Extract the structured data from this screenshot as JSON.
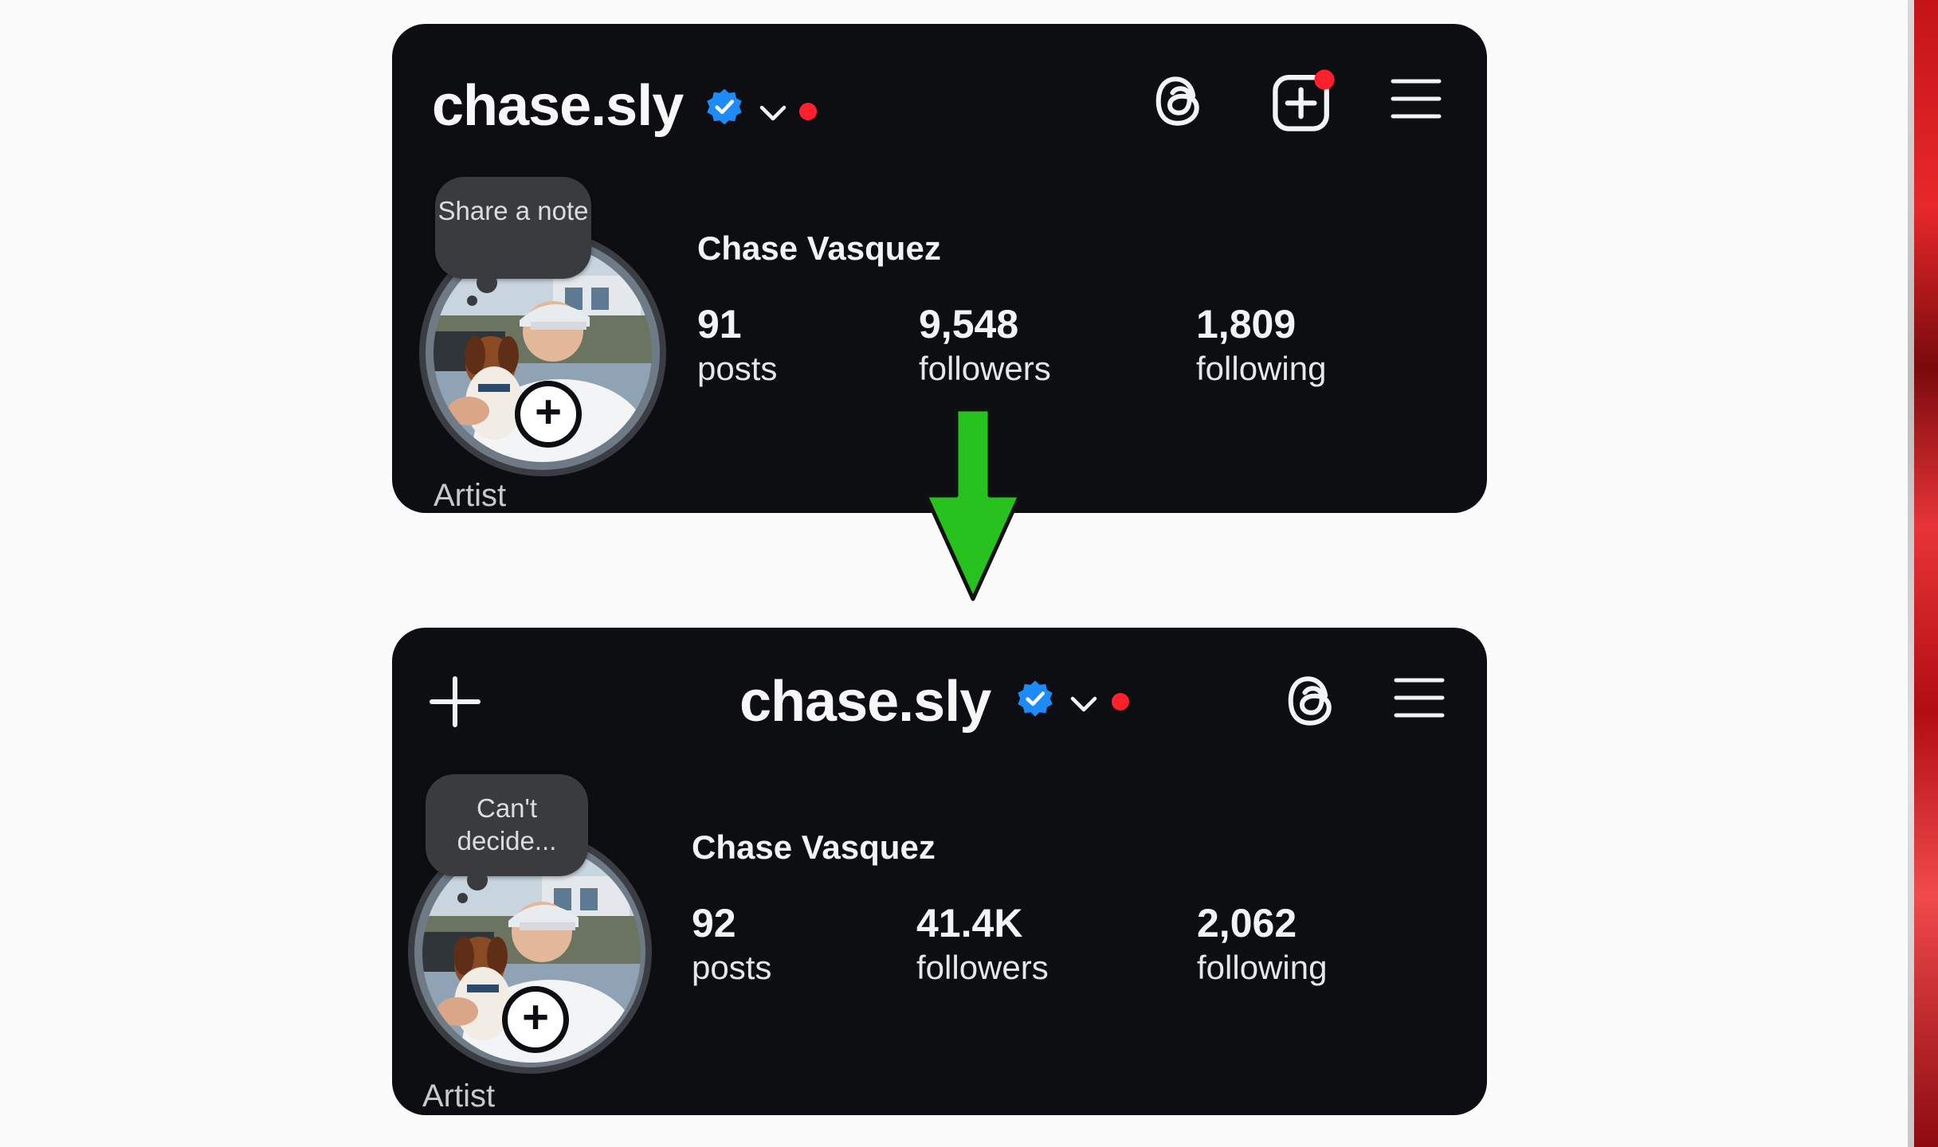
{
  "colors": {
    "card_background": "#0c0e12",
    "verified_blue": "#1d8cf8",
    "notification_red": "#ff1f2d",
    "arrow_green": "#27c21d"
  },
  "before": {
    "username": "chase.sly",
    "note": "Share a note",
    "full_name": "Chase Vasquez",
    "stats": {
      "posts_count": "91",
      "posts_label": "posts",
      "followers_count": "9,548",
      "followers_label": "followers",
      "following_count": "1,809",
      "following_label": "following"
    },
    "category": "Artist",
    "icons": [
      "verified-badge-icon",
      "chevron-down-icon",
      "threads-icon",
      "create-post-icon",
      "menu-icon"
    ]
  },
  "after": {
    "username": "chase.sly",
    "note": "Can't decide...",
    "full_name": "Chase Vasquez",
    "stats": {
      "posts_count": "92",
      "posts_label": "posts",
      "followers_count": "41.4K",
      "followers_label": "followers",
      "following_count": "2,062",
      "following_label": "following"
    },
    "category": "Artist",
    "icons": [
      "plus-icon",
      "verified-badge-icon",
      "chevron-down-icon",
      "threads-icon",
      "menu-icon"
    ]
  }
}
